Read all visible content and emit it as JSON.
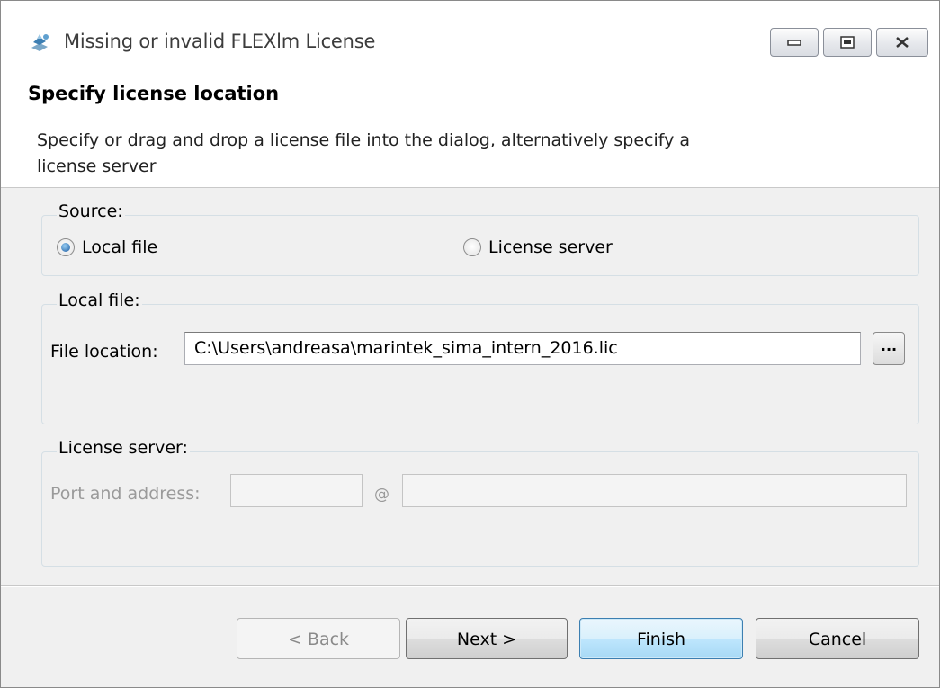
{
  "window": {
    "title": "Missing or invalid FLEXlm License"
  },
  "banner": {
    "title": "Specify license location",
    "description": "Specify or drag and drop a license file into the dialog, alternatively specify a license server"
  },
  "source": {
    "label": "Source:",
    "options": [
      {
        "label": "Local file",
        "selected": true
      },
      {
        "label": "License server",
        "selected": false
      }
    ]
  },
  "local_file": {
    "label": "Local file:",
    "file_location_label": "File location:",
    "file_location_value": "C:\\Users\\andreasa\\marintek_sima_intern_2016.lic",
    "browse_label": "..."
  },
  "license_server": {
    "label": "License server:",
    "port_address_label": "Port and address:",
    "at": "@",
    "port_value": "",
    "address_value": ""
  },
  "buttons": {
    "back": "< Back",
    "next": "Next >",
    "finish": "Finish",
    "cancel": "Cancel"
  }
}
